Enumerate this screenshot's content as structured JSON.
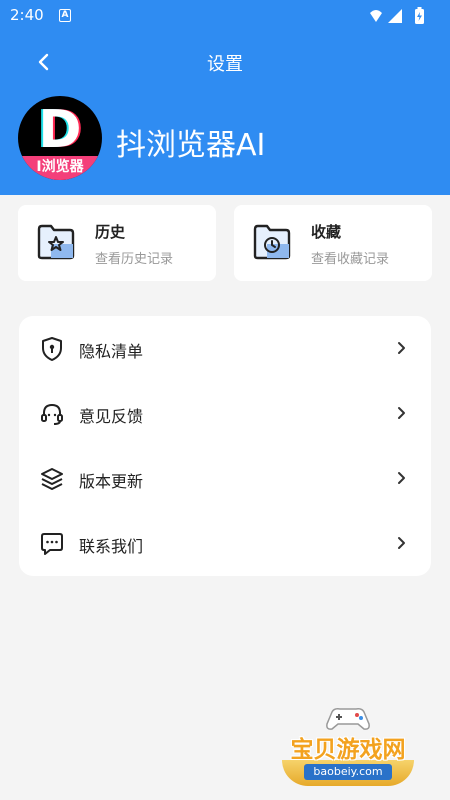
{
  "status_bar": {
    "time": "2:40",
    "notification_badge": "A"
  },
  "header": {
    "title": "设置",
    "app_name": "抖浏览器AI",
    "avatar_letter": "D",
    "avatar_band_text": "I浏览器"
  },
  "cards": [
    {
      "title": "历史",
      "subtitle": "查看历史记录",
      "icon": "folder-star-icon"
    },
    {
      "title": "收藏",
      "subtitle": "查看收藏记录",
      "icon": "folder-clock-icon"
    }
  ],
  "menu": [
    {
      "label": "隐私清单",
      "icon": "shield-lock-icon"
    },
    {
      "label": "意见反馈",
      "icon": "headset-icon"
    },
    {
      "label": "版本更新",
      "icon": "layers-icon"
    },
    {
      "label": "联系我们",
      "icon": "chat-icon"
    }
  ],
  "watermark": {
    "text": "宝贝游戏网",
    "url": "baobeiy.com"
  },
  "colors": {
    "header_bg": "#2f8cf2",
    "page_bg": "#f4f4f4",
    "watermark_orange": "#f3a21f"
  }
}
